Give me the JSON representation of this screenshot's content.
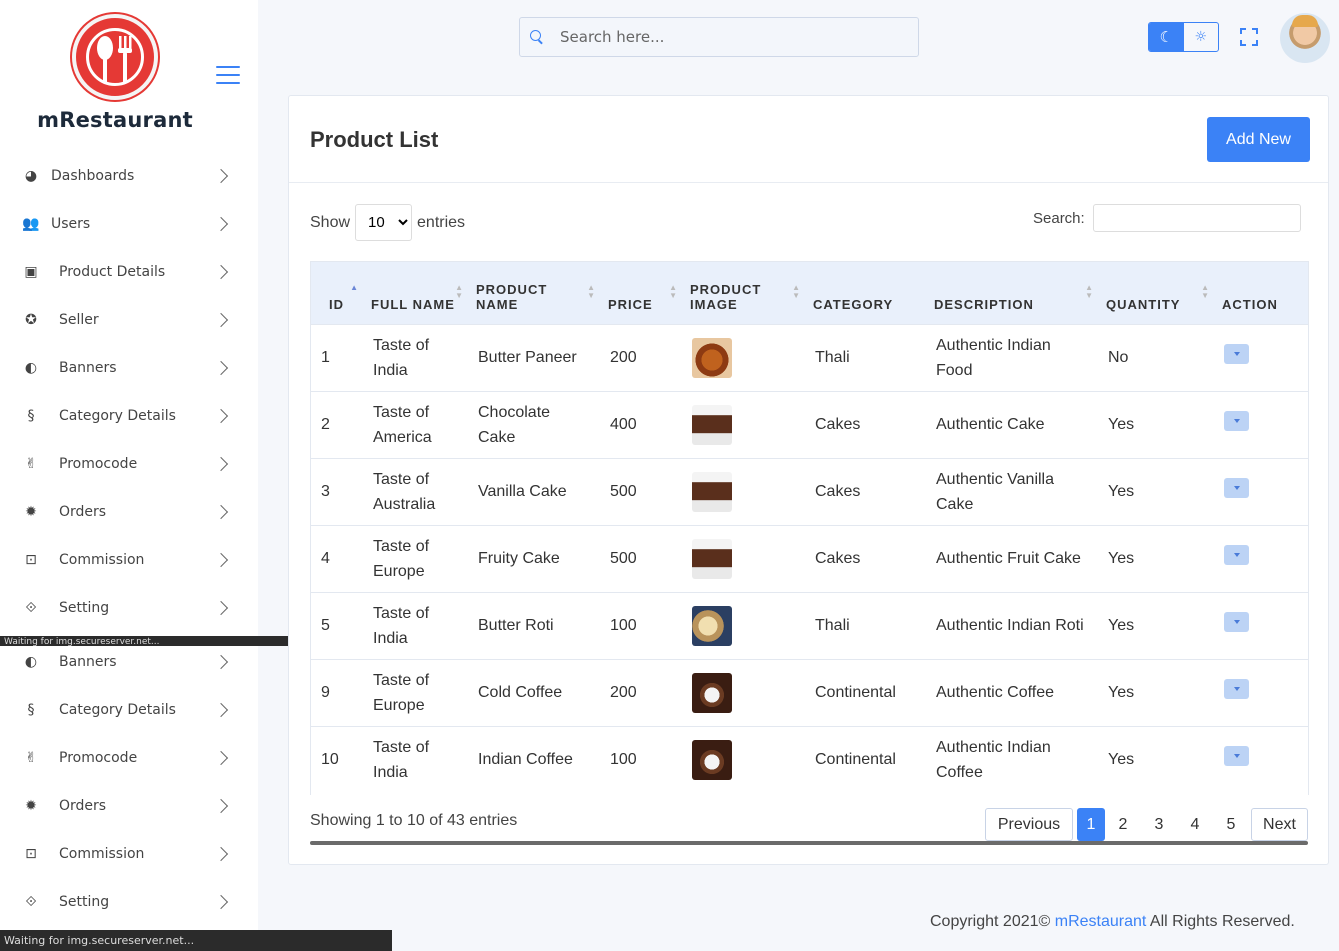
{
  "brand": {
    "name": "mRestaurant"
  },
  "header": {
    "search_placeholder": "Search here..."
  },
  "sidebar": {
    "items": [
      {
        "label": "Dashboards",
        "icon": "dashboard-icon",
        "glyph": "◕"
      },
      {
        "label": "Users",
        "icon": "users-icon",
        "glyph": "👥"
      },
      {
        "label": "Product Details",
        "icon": "product-icon",
        "glyph": "▣"
      },
      {
        "label": "Seller",
        "icon": "seller-icon",
        "glyph": "✪"
      },
      {
        "label": "Banners",
        "icon": "banners-icon",
        "glyph": "◐"
      },
      {
        "label": "Category Details",
        "icon": "category-icon",
        "glyph": "§"
      },
      {
        "label": "Promocode",
        "icon": "promocode-icon",
        "glyph": "✌"
      },
      {
        "label": "Orders",
        "icon": "orders-icon",
        "glyph": "✹"
      },
      {
        "label": "Commission",
        "icon": "commission-icon",
        "glyph": "⊡"
      },
      {
        "label": "Setting",
        "icon": "setting-icon",
        "glyph": "⟐"
      }
    ],
    "repeated_items": [
      {
        "label": "Banners",
        "icon": "banners-icon",
        "glyph": "◐"
      },
      {
        "label": "Category Details",
        "icon": "category-icon",
        "glyph": "§"
      },
      {
        "label": "Promocode",
        "icon": "promocode-icon",
        "glyph": "✌"
      },
      {
        "label": "Orders",
        "icon": "orders-icon",
        "glyph": "✹"
      },
      {
        "label": "Commission",
        "icon": "commission-icon",
        "glyph": "⊡"
      },
      {
        "label": "Setting",
        "icon": "setting-icon",
        "glyph": "⟐"
      }
    ]
  },
  "status_text": "Waiting for img.secureserver.net...",
  "main": {
    "title": "Product List",
    "add_label": "Add New",
    "show_label": "Show",
    "entries_label": "entries",
    "entries_value": "10",
    "search_label": "Search:",
    "columns": [
      "ID",
      "FULL NAME",
      "PRODUCT NAME",
      "PRICE",
      "PRODUCT IMAGE",
      "CATEGORY",
      "DESCRIPTION",
      "QUANTITY",
      "ACTION"
    ],
    "rows": [
      {
        "id": "1",
        "full_name": "Taste of India",
        "product": "Butter Paneer",
        "price": "200",
        "img": "thali",
        "category": "Thali",
        "description": "Authentic Indian Food",
        "quantity": "No"
      },
      {
        "id": "2",
        "full_name": "Taste of America",
        "product": "Chocolate Cake",
        "price": "400",
        "img": "cake",
        "category": "Cakes",
        "description": "Authentic Cake",
        "quantity": "Yes"
      },
      {
        "id": "3",
        "full_name": "Taste of Australia",
        "product": "Vanilla Cake",
        "price": "500",
        "img": "cake",
        "category": "Cakes",
        "description": "Authentic Vanilla Cake",
        "quantity": "Yes"
      },
      {
        "id": "4",
        "full_name": "Taste of Europe",
        "product": "Fruity Cake",
        "price": "500",
        "img": "cake",
        "category": "Cakes",
        "description": "Authentic Fruit Cake",
        "quantity": "Yes"
      },
      {
        "id": "5",
        "full_name": "Taste of India",
        "product": "Butter Roti",
        "price": "100",
        "img": "roti",
        "category": "Thali",
        "description": "Authentic Indian Roti",
        "quantity": "Yes"
      },
      {
        "id": "9",
        "full_name": "Taste of Europe",
        "product": "Cold Coffee",
        "price": "200",
        "img": "coffee",
        "category": "Continental",
        "description": "Authentic Coffee",
        "quantity": "Yes"
      },
      {
        "id": "10",
        "full_name": "Taste of India",
        "product": "Indian Coffee",
        "price": "100",
        "img": "coffee",
        "category": "Continental",
        "description": "Authentic Indian Coffee",
        "quantity": "Yes"
      }
    ],
    "showing_text": "Showing 1 to 10 of 43 entries",
    "pagination": {
      "previous": "Previous",
      "pages": [
        "1",
        "2",
        "3",
        "4",
        "5"
      ],
      "active": "1",
      "next": "Next"
    }
  },
  "footer": {
    "prefix": "Copyright 2021©",
    "brand": "mRestaurant",
    "suffix": "All Rights Reserved."
  },
  "colors": {
    "accent": "#3b82f6",
    "logo": "#e53935"
  }
}
